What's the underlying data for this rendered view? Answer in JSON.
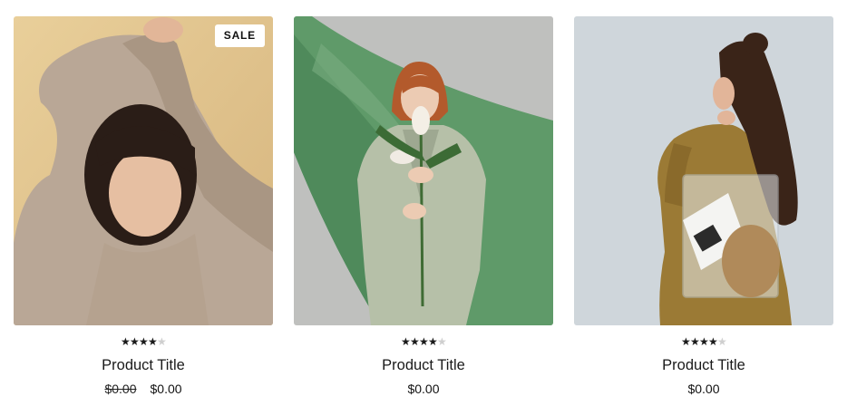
{
  "products": [
    {
      "badge": "SALE",
      "rating": 4,
      "rating_max": 5,
      "title": "Product Title",
      "compare_price": "$0.00",
      "price": "$0.00"
    },
    {
      "rating": 4,
      "rating_max": 5,
      "title": "Product Title",
      "price": "$0.00"
    },
    {
      "rating": 4,
      "rating_max": 5,
      "title": "Product Title",
      "price": "$0.00"
    }
  ],
  "icons": {
    "star_full": "star-icon",
    "star_empty": "star-outline-icon"
  },
  "colors": {
    "star_full": "#1a1a1a",
    "star_empty": "#cfcfcf",
    "badge_bg": "#ffffff"
  }
}
